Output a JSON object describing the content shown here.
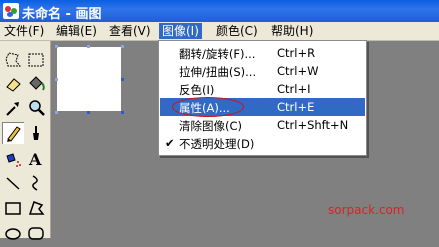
{
  "window": {
    "title": "未命名 - 画图"
  },
  "menubar": [
    {
      "label": "文件(F)"
    },
    {
      "label": "编辑(E)"
    },
    {
      "label": "查看(V)"
    },
    {
      "label": "图像(I)"
    },
    {
      "label": "颜色(C)"
    },
    {
      "label": "帮助(H)"
    }
  ],
  "image_menu": {
    "items": [
      {
        "label": "翻转/旋转(F)...",
        "shortcut": "Ctrl+R"
      },
      {
        "label": "拉伸/扭曲(S)...",
        "shortcut": "Ctrl+W"
      },
      {
        "label": "反色(I)",
        "shortcut": "Ctrl+I"
      },
      {
        "label": "属性(A)...",
        "shortcut": "Ctrl+E",
        "highlighted": true
      },
      {
        "label": "清除图像(C)",
        "shortcut": "Ctrl+Shft+N"
      },
      {
        "label": "不透明处理(D)",
        "shortcut": "",
        "checked": true
      }
    ]
  },
  "watermark": "sorpack.com",
  "colors": {
    "title_bar": "#0a5fe0",
    "menu_highlight": "#316ac5",
    "workspace": "#808080",
    "annotation": "#d01010"
  }
}
